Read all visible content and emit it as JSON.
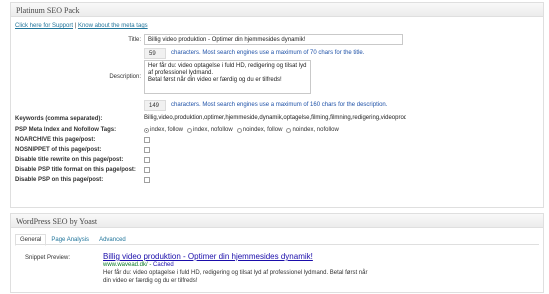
{
  "psp": {
    "header": "Platinum SEO Pack",
    "support_link": "Click here for Support",
    "separator": "|",
    "meta_link": "Know about the meta tags",
    "title_label": "Title:",
    "title_value": "Billig video produktion - Optimer din hjemmesides dynamik!",
    "title_count": "59",
    "title_hint": "characters. Most search engines use a maximum of 70 chars for the title.",
    "desc_label": "Description:",
    "desc_value": "Her får du: video optagelse i fuld HD, redigering og tilsat lyd af professionel lydmand.\nBetal først når din video er færdig og du er tilfreds!",
    "desc_count": "149",
    "desc_hint": "characters. Most search engines use a maximum of 160 chars for the description.",
    "keywords_label": "Keywords (comma separated):",
    "keywords_value": "Billig,video,produktion,optimer,hjemmeside,dynamik,optagelse,filming,filmning,redigering,videoprodukt",
    "meta_index_label": "PSP Meta Index and Nofollow Tags:",
    "radios": [
      {
        "label": "index, follow",
        "checked": true
      },
      {
        "label": "index, nofollow",
        "checked": false
      },
      {
        "label": "noindex, follow",
        "checked": false
      },
      {
        "label": "noindex, nofollow",
        "checked": false
      }
    ],
    "checks": [
      "NOARCHIVE this page/post:",
      "NOSNIPPET of this page/post:",
      "Disable title rewrite on this page/post:",
      "Disable PSP title format on this page/post:",
      "Disable PSP on this page/post:"
    ]
  },
  "yoast": {
    "header": "WordPress SEO by Yoast",
    "tabs": [
      "General",
      "Page Analysis",
      "Advanced"
    ],
    "snippet_label": "Snippet Preview:",
    "snippet_title": "Billig video produktion - Optimer din hjemmesides dynamik!",
    "snippet_url": "www.wavead.dk/ - ",
    "snippet_cached": "Cached",
    "snippet_desc": "Her får du: video optagelse i fuld HD, redigering og tilsat lyd af professionel lydmand. Betal først når din video er færdig og du er tilfreds!"
  }
}
